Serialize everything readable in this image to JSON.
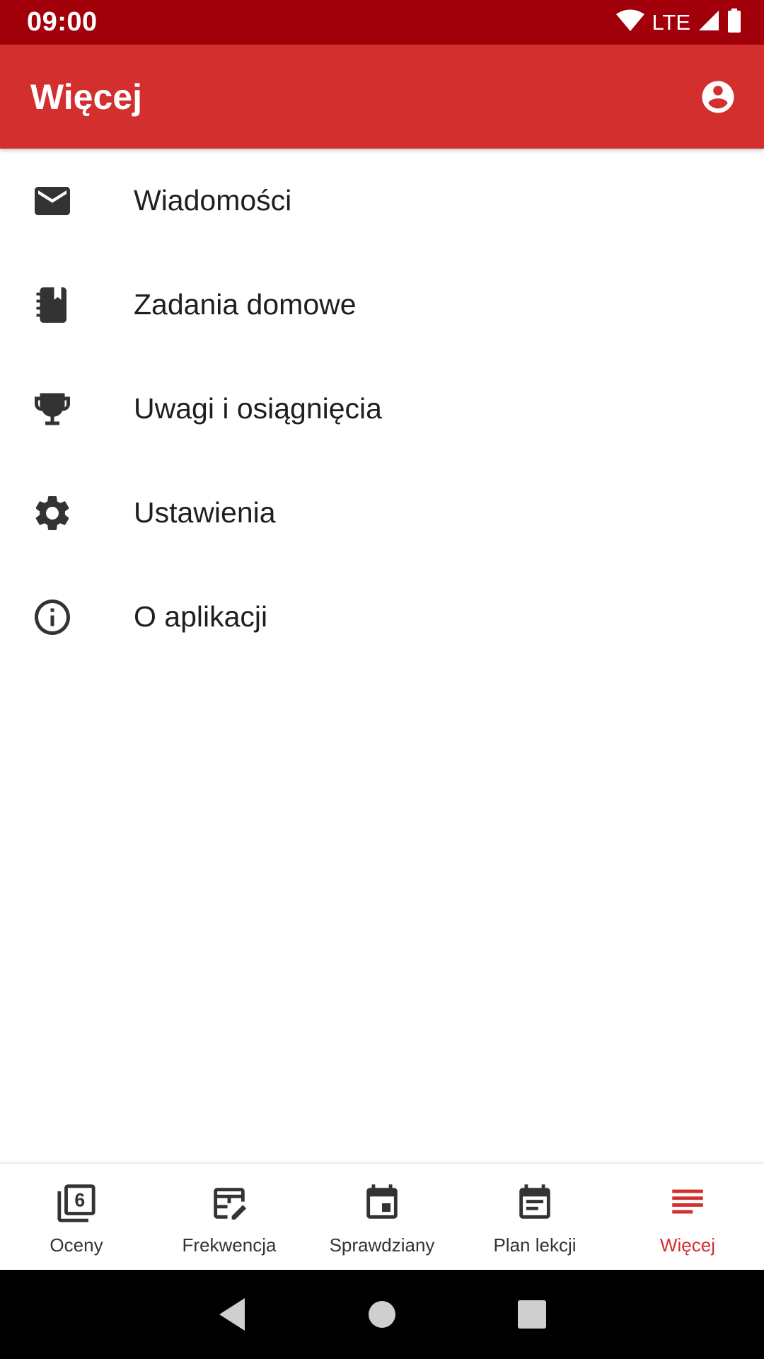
{
  "status_bar": {
    "time": "09:00",
    "network": "LTE"
  },
  "app_bar": {
    "title": "Więcej",
    "account_icon": "account-circle-icon"
  },
  "menu": {
    "items": [
      {
        "label": "Wiadomości",
        "icon": "mail-icon"
      },
      {
        "label": "Zadania domowe",
        "icon": "homework-notebook-icon"
      },
      {
        "label": "Uwagi i osiągnięcia",
        "icon": "trophy-icon"
      },
      {
        "label": "Ustawienia",
        "icon": "gear-icon"
      },
      {
        "label": "O aplikacji",
        "icon": "info-icon"
      }
    ]
  },
  "bottom_nav": {
    "items": [
      {
        "label": "Oceny",
        "icon": "grades-icon"
      },
      {
        "label": "Frekwencja",
        "icon": "attendance-icon"
      },
      {
        "label": "Sprawdziany",
        "icon": "calendar-icon"
      },
      {
        "label": "Plan lekcji",
        "icon": "timetable-icon"
      },
      {
        "label": "Więcej",
        "icon": "more-menu-icon",
        "active": true
      }
    ]
  },
  "colors": {
    "primary": "#d32f2f",
    "status_bar": "#a1000b",
    "icon_dark": "#333333",
    "active": "#d32f2f"
  }
}
